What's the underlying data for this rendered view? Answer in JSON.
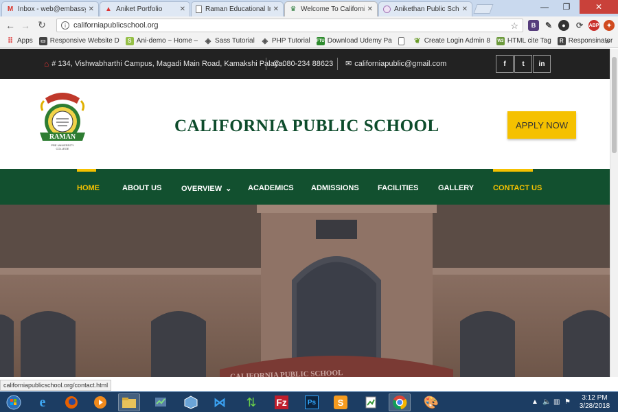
{
  "tabs": [
    {
      "title": "Inbox - web@embassyit",
      "icon": "gmail-icon"
    },
    {
      "title": "Aniket Portfolio",
      "icon": "triangle-icon"
    },
    {
      "title": "Raman Educational Instit",
      "icon": "page-icon"
    },
    {
      "title": "Welcome To California P",
      "icon": "school-crest-icon"
    },
    {
      "title": "Anikethan Public School",
      "icon": "circle-logo-icon"
    }
  ],
  "url": "californiapublicschool.org",
  "bookmarks": [
    "Apps",
    "Responsive Website D",
    "Ani-demo ~ Home –",
    "Sass Tutorial",
    "PHP Tutorial",
    "Download Udemy Pa",
    "Create Login Admin 8",
    "HTML cite Tag",
    "Responsinator"
  ],
  "bookmark_overflow": "»",
  "topbar": {
    "address": "# 134, Vishwabharthi Campus, Magadi Main Road, Kamakshi Palaya.",
    "phone": "080-234 88623",
    "email": "californiapublic@gmail.com",
    "social": [
      "f",
      "t",
      "in"
    ]
  },
  "logo": {
    "banner": "RAMAN",
    "sub": "PRE UNIVERSITY COLLEGE"
  },
  "school_name": "CALIFORNIA PUBLIC SCHOOL",
  "apply_label": "APPLY NOW",
  "nav": [
    "HOME",
    "ABOUT US",
    "OVERVIEW",
    "ACADEMICS",
    "ADMISSIONS",
    "FACILITIES",
    "GALLERY",
    "CONTACT US"
  ],
  "nav_caret": "⌄",
  "hero_sign": "CALIFORNIA PUBLIC SCHOOL",
  "status_url": "californiapublicschool.org/contact.html",
  "clock": {
    "time": "3:12 PM",
    "date": "3/28/2018"
  },
  "colors": {
    "brand_green": "#12502f",
    "accent_yellow": "#f5c100",
    "topbar": "#222222"
  }
}
